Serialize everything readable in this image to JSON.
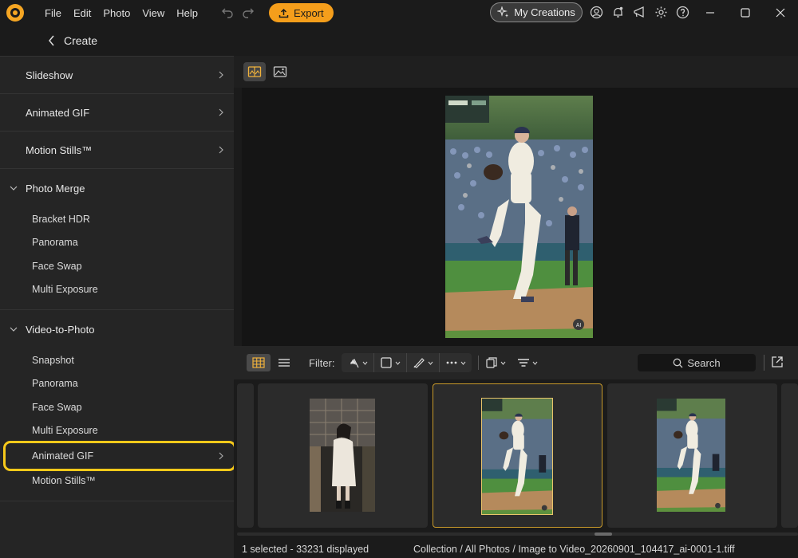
{
  "menu": [
    "File",
    "Edit",
    "Photo",
    "View",
    "Help"
  ],
  "export_label": "Export",
  "my_creations_label": "My Creations",
  "back_label": "Create",
  "sidebar": {
    "top_items": [
      {
        "label": "Slideshow"
      },
      {
        "label": "Animated GIF"
      },
      {
        "label": "Motion Stills™"
      }
    ],
    "groups": [
      {
        "label": "Photo Merge",
        "items": [
          "Bracket HDR",
          "Panorama",
          "Face Swap",
          "Multi Exposure"
        ]
      },
      {
        "label": "Video-to-Photo",
        "items": [
          "Snapshot",
          "Panorama",
          "Face Swap",
          "Multi Exposure",
          "Animated GIF",
          "Motion Stills™"
        ],
        "highlighted": "Animated GIF"
      }
    ]
  },
  "filterbar": {
    "filter_label": "Filter:",
    "search_placeholder": "Search"
  },
  "status": {
    "selection": "1 selected - 33231 displayed",
    "path": "Collection / All Photos / Image to Video_20260901_104417_ai-0001-1.tiff"
  },
  "preview": {
    "ai_badge": "AI"
  },
  "colors": {
    "accent": "#f59e1b",
    "highlight": "#f7c91a",
    "selected_border": "#c89a2a"
  }
}
